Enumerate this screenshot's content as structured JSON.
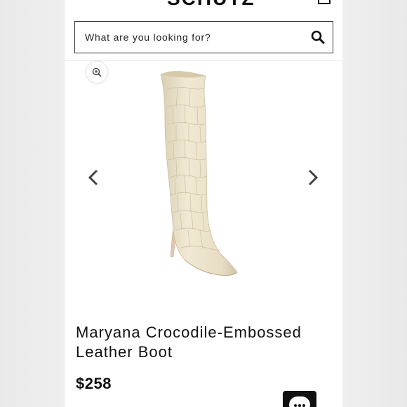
{
  "header": {
    "brand": "SCHUTZ"
  },
  "search": {
    "placeholder": "What are you looking for?"
  },
  "gallery": {
    "zoom_icon": "zoom-in-icon",
    "prev_icon": "chevron-left-icon",
    "next_icon": "chevron-right-icon"
  },
  "product": {
    "name": "Maryana Crocodile-Embossed Leather Boot",
    "price": "$258"
  },
  "colors": {
    "text": "#111111",
    "boot": "#eee4cc"
  }
}
